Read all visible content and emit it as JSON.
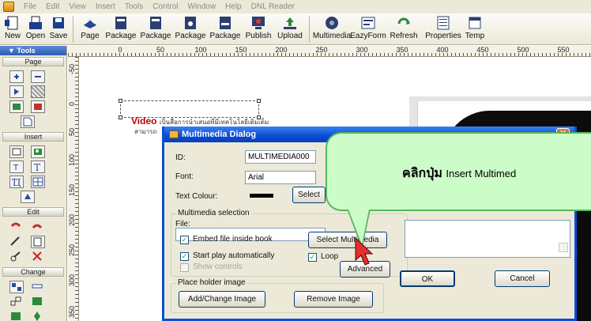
{
  "menu": [
    "File",
    "Edit",
    "View",
    "Insert",
    "Tools",
    "Control",
    "Window",
    "Help",
    "DNL Reader"
  ],
  "toolbar": [
    {
      "label": "New",
      "icon": "new-page-icon"
    },
    {
      "label": "Open",
      "icon": "open-folder-icon"
    },
    {
      "label": "Save",
      "icon": "save-disk-icon"
    },
    {
      "label": "Page",
      "icon": "page-icon"
    },
    {
      "label": "Package",
      "icon": "package-icon"
    },
    {
      "label": "Package",
      "icon": "package-icon"
    },
    {
      "label": "Package",
      "icon": "package-icon"
    },
    {
      "label": "Package",
      "icon": "package-icon"
    },
    {
      "label": "Publish",
      "icon": "publish-icon"
    },
    {
      "label": "Upload",
      "icon": "upload-icon"
    },
    {
      "label": "Multimedia",
      "icon": "multimedia-icon"
    },
    {
      "label": "EazyForm",
      "icon": "form-icon"
    },
    {
      "label": "Refresh",
      "icon": "refresh-icon"
    },
    {
      "label": "Properties",
      "icon": "properties-icon"
    },
    {
      "label": "Temp",
      "icon": "template-icon"
    }
  ],
  "tools": {
    "header": "Tools",
    "sections": [
      "Page",
      "Insert",
      "Edit",
      "Change"
    ]
  },
  "ruler": {
    "h_labels": [
      "0",
      "50",
      "100",
      "150",
      "200",
      "250",
      "300",
      "350",
      "400",
      "450",
      "500",
      "550"
    ],
    "v_labels": [
      "-50",
      "0",
      "50",
      "100",
      "150",
      "200",
      "250",
      "300",
      "350"
    ]
  },
  "canvas": {
    "heading_bold": "Video",
    "heading_rest": "เป็นสื่อการนำเสนอที่มีเทคโนโลยีเติมเต็ม",
    "sub_text": "สามารถ"
  },
  "dialog": {
    "title": "Multimedia Dialog",
    "close": "✕",
    "id_label": "ID:",
    "id_value": "MULTIMEDIA000",
    "font_label": "Font:",
    "font_value": "Arial",
    "text_colour_label": "Text Colour:",
    "select_colour_button": "Select",
    "multimedia_group": "Multimedia selection",
    "file_label": "File:",
    "file_value": "",
    "embed_label": "Embed file inside book",
    "select_multimedia_button": "Select Multimedia",
    "start_play_label": "Start play automatically",
    "loop_label": "Loop",
    "show_controls_label": "Show controls",
    "advanced_button": "Advanced",
    "placeholder_group": "Place holder image",
    "add_change_image_button": "Add/Change Image",
    "remove_image_button": "Remove Image",
    "ok_button": "OK",
    "cancel_button": "Cancel",
    "embed_checked": true,
    "start_play_checked": true,
    "loop_checked": true,
    "show_controls_checked": false
  },
  "callout": {
    "thai_text": "คลิกปุ่ม",
    "rest_text": "Insert Multimed"
  }
}
